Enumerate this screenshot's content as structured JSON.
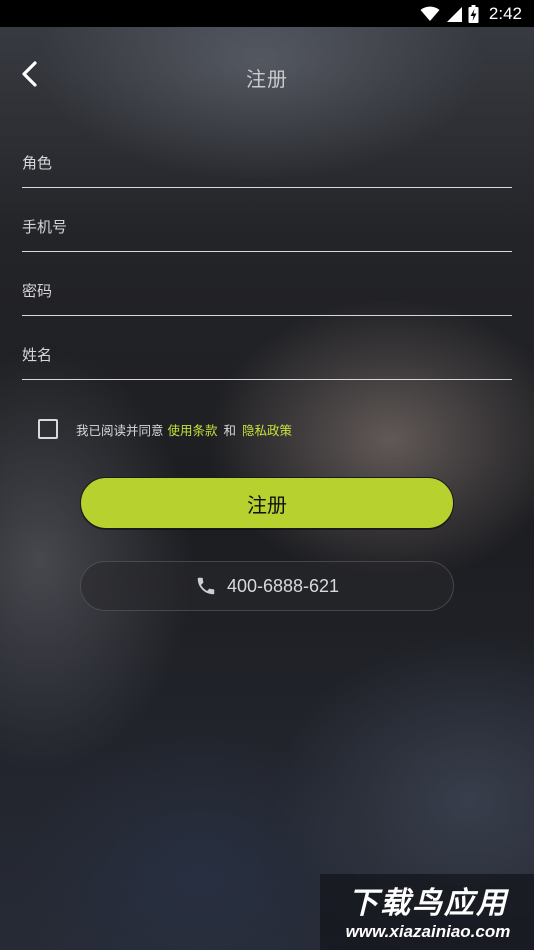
{
  "status_bar": {
    "time": "2:42"
  },
  "header": {
    "title": "注册"
  },
  "form": {
    "role_placeholder": "角色",
    "phone_placeholder": "手机号",
    "password_placeholder": "密码",
    "name_placeholder": "姓名"
  },
  "agreement": {
    "checked": false,
    "prefix": "我已阅读并同意",
    "terms_link": "使用条款",
    "and": "和",
    "privacy_link": "隐私政策"
  },
  "buttons": {
    "register_label": "注册",
    "phone_number": "400-6888-621"
  },
  "icons": {
    "back": "chevron-left-icon",
    "phone": "phone-icon",
    "wifi": "wifi-icon",
    "signal": "signal-icon",
    "battery": "battery-charging-icon"
  },
  "colors": {
    "accent": "#b7d22f",
    "link": "#c6e03a"
  },
  "watermark": {
    "title": "下载鸟应用",
    "url": "www.xiazainiao.com"
  }
}
